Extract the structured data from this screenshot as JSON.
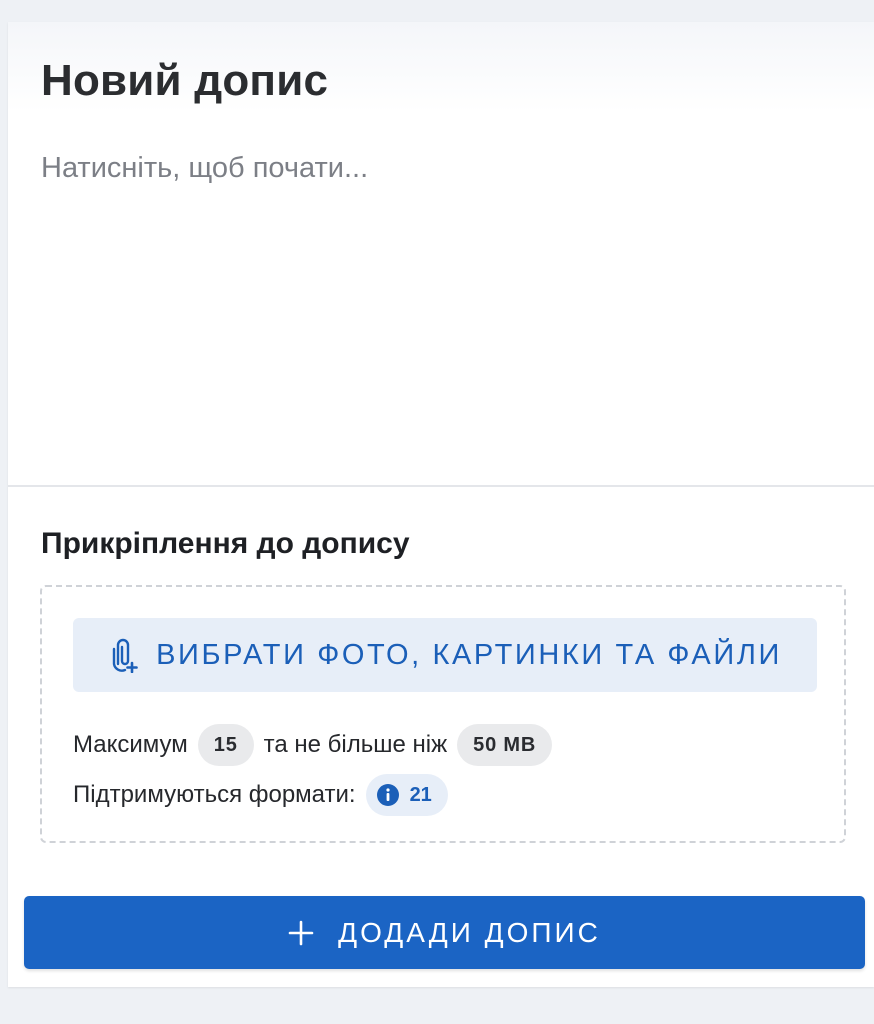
{
  "post": {
    "title": "Новий допис",
    "editor_placeholder": "Натисніть, щоб почати...",
    "editor_value": ""
  },
  "attachments": {
    "section_title": "Прикріплення до допису",
    "pick_button_label": "ВИБРАТИ ФОТО, КАРТИНКИ ТА ФАЙЛИ",
    "pick_button_icon": "paperclip-add-icon",
    "limits": {
      "prefix": "Максимум",
      "max_count": "15",
      "middle": "та не більше ніж",
      "max_size": "50 MB"
    },
    "formats": {
      "label": "Підтримуються формати:",
      "icon": "info-icon",
      "count": "21"
    }
  },
  "actions": {
    "add_post_label": "ДОДАДИ ДОПИС",
    "add_post_icon": "plus-icon"
  },
  "colors": {
    "accent": "#1b64c4",
    "accent_text": "#1b5fb8",
    "accent_soft": "#e7eef8",
    "chip_bg": "#e9eaec",
    "page_bg": "#eef1f5"
  }
}
